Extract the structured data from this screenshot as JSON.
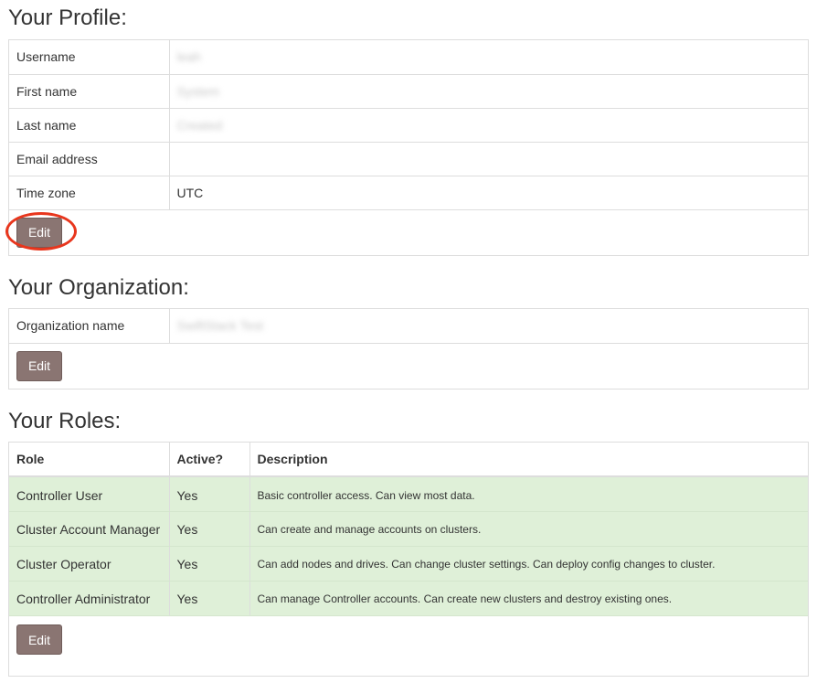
{
  "profile": {
    "title": "Your Profile:",
    "rows": [
      {
        "label": "Username",
        "value": "leah"
      },
      {
        "label": "First name",
        "value": "System"
      },
      {
        "label": "Last name",
        "value": "Created"
      },
      {
        "label": "Email address",
        "value": ""
      },
      {
        "label": "Time zone",
        "value": "UTC"
      }
    ],
    "edit_label": "Edit"
  },
  "organization": {
    "title": "Your Organization:",
    "rows": [
      {
        "label": "Organization name",
        "value": "SwiftStack Test"
      }
    ],
    "edit_label": "Edit"
  },
  "roles": {
    "title": "Your Roles:",
    "headers": {
      "role": "Role",
      "active": "Active?",
      "description": "Description"
    },
    "rows": [
      {
        "role": "Controller User",
        "active": "Yes",
        "description": "Basic controller access. Can view most data."
      },
      {
        "role": "Cluster Account Manager",
        "active": "Yes",
        "description": "Can create and manage accounts on clusters."
      },
      {
        "role": "Cluster Operator",
        "active": "Yes",
        "description": "Can add nodes and drives. Can change cluster settings. Can deploy config changes to cluster."
      },
      {
        "role": "Controller Administrator",
        "active": "Yes",
        "description": "Can manage Controller accounts. Can create new clusters and destroy existing ones."
      }
    ],
    "edit_label": "Edit"
  },
  "colors": {
    "button_bg": "#8a7572",
    "active_row_bg": "#dff0d8",
    "highlight_ring": "#e8361d"
  }
}
